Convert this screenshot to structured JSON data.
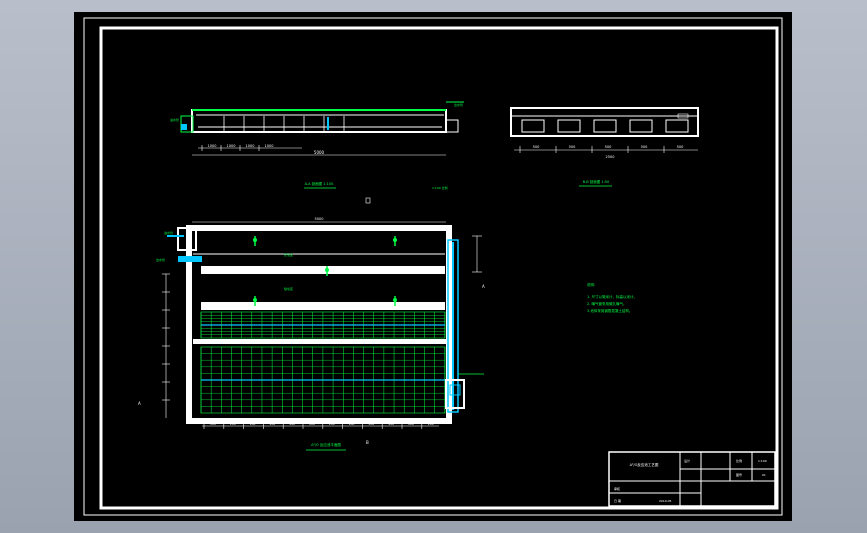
{
  "drawing": {
    "colors": {
      "frame": "#ffffff",
      "background": "#000000",
      "accent_green": "#00ff44",
      "accent_cyan": "#00c8ff"
    },
    "elevation_a": {
      "title": "A-A 剖面图 1:100",
      "overall_dim": "5000",
      "segment_dims": [
        "1000",
        "1000",
        "1000",
        "1000"
      ],
      "left_label": "进水管",
      "right_label": "出水管"
    },
    "elevation_b": {
      "title": "B-B 剖面图 1:50",
      "segment_dims": [
        "500",
        "500",
        "500",
        "500",
        "500"
      ],
      "overall_dim": "2500"
    },
    "scale_note": "1:100 比例",
    "plan": {
      "title": "A²/O 反应池平面图",
      "top_dim": "5000",
      "bottom_dims": [
        "200",
        "200",
        "200",
        "200",
        "200",
        "200",
        "200",
        "200",
        "200",
        "200",
        "200",
        "200"
      ],
      "left_labels": [
        "进水管",
        "出水管"
      ],
      "zone_labels": [
        "厌氧区",
        "缺氧区"
      ],
      "side_mark": "A"
    },
    "notes": {
      "heading": "说明：",
      "lines": [
        "1. 尺寸以毫米计，标高以米计。",
        "2. 曝气管采用微孔曝气。",
        "3.池体采用钢筋混凝土结构。"
      ]
    },
    "title_block": {
      "name": "A²/O反应池工艺图",
      "rows": [
        {
          "label": "设计",
          "value": "",
          "extra": "比例",
          "extra_value": "1:100"
        },
        {
          "label": "",
          "value": "",
          "extra": "图号",
          "extra_value": "01"
        },
        {
          "label": "审核",
          "value": "",
          "extra": "",
          "extra_value": ""
        },
        {
          "label": "日 期",
          "value": "2019.05",
          "extra": "",
          "extra_value": ""
        }
      ]
    }
  }
}
